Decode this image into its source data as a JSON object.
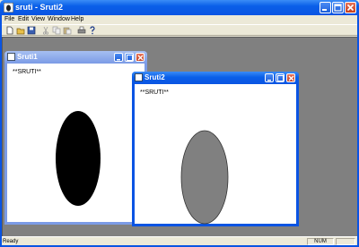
{
  "app": {
    "title": "sruti - Sruti2",
    "menu": [
      "File",
      "Edit",
      "View",
      "Window",
      "Help"
    ],
    "toolbar_icons": [
      "new-icon",
      "open-icon",
      "save-icon",
      "cut-icon",
      "copy-icon",
      "paste-icon",
      "print-icon",
      "help-icon"
    ],
    "colors": {
      "titlebar": "#0a54e3",
      "close": "#c5401f",
      "mdi_background": "#808080",
      "client": "#ece9d8"
    }
  },
  "windows": {
    "sruti1": {
      "title": "Sruti1",
      "text": "**SRUTI**",
      "shape": {
        "kind": "ellipse",
        "fill": "#000000"
      }
    },
    "sruti2": {
      "title": "Sruti2",
      "text": "**SRUTI**",
      "shape": {
        "kind": "ellipse",
        "fill": "#808080"
      }
    }
  },
  "status": {
    "text": "Ready",
    "indicator": "NUM"
  }
}
